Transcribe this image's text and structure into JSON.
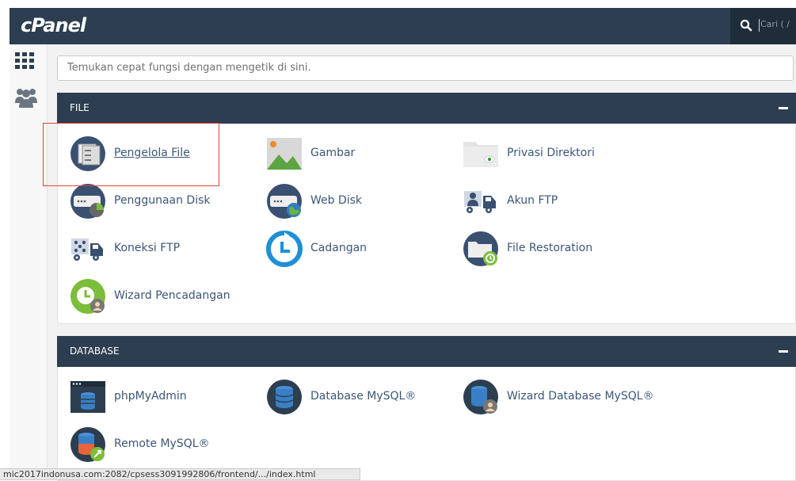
{
  "header": {
    "logo": "cPanel",
    "search_placeholder": "Cari ( /"
  },
  "sidebar": {
    "items": [
      {
        "icon": "grid-icon"
      },
      {
        "icon": "users-icon"
      }
    ]
  },
  "quick_search": {
    "placeholder": "Temukan cepat fungsi dengan mengetik di sini."
  },
  "sections": [
    {
      "title": "FILE",
      "items": [
        {
          "label": "Pengelola File",
          "icon": "file-manager-icon"
        },
        {
          "label": "Gambar",
          "icon": "images-icon"
        },
        {
          "label": "Privasi Direktori",
          "icon": "directory-privacy-icon"
        },
        {
          "label": "Penggunaan Disk",
          "icon": "disk-usage-icon"
        },
        {
          "label": "Web Disk",
          "icon": "web-disk-icon"
        },
        {
          "label": "Akun FTP",
          "icon": "ftp-accounts-icon"
        },
        {
          "label": "Koneksi FTP",
          "icon": "ftp-connections-icon"
        },
        {
          "label": "Cadangan",
          "icon": "backup-icon"
        },
        {
          "label": "File Restoration",
          "icon": "file-restoration-icon"
        },
        {
          "label": "Wizard Pencadangan",
          "icon": "backup-wizard-icon"
        }
      ]
    },
    {
      "title": "DATABASE",
      "items": [
        {
          "label": "phpMyAdmin",
          "icon": "phpmyadmin-icon"
        },
        {
          "label": "Database MySQL®",
          "icon": "mysql-database-icon"
        },
        {
          "label": "Wizard Database MySQL®",
          "icon": "mysql-wizard-icon"
        },
        {
          "label": "Remote MySQL®",
          "icon": "remote-mysql-icon"
        }
      ]
    }
  ],
  "status_bar": {
    "url": "mic2017indonusa.com:2082/cpsess3091992806/frontend/.../index.html"
  },
  "colors": {
    "header_bg": "#2c3e50",
    "link": "#3b5776",
    "highlight_border": "#e0413a"
  }
}
